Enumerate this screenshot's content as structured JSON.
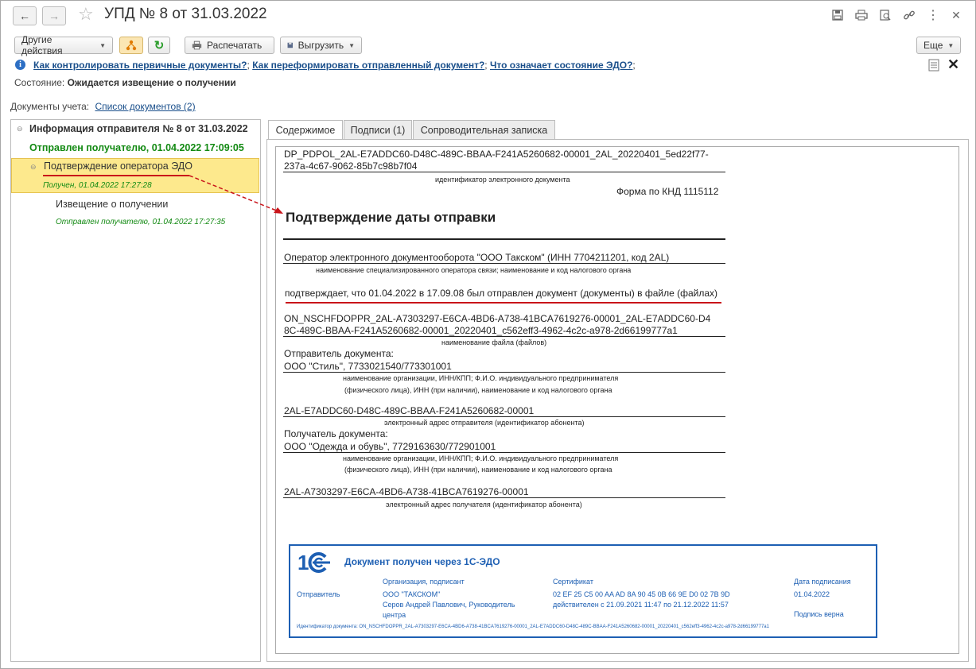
{
  "window": {
    "title": "УПД № 8 от 31.03.2022",
    "back_icon": "←",
    "forward_icon": "→",
    "star_icon": "☆"
  },
  "toolbar": {
    "other_actions": "Другие действия",
    "print": "Распечатать",
    "export": "Выгрузить",
    "more": "Еще"
  },
  "help_links": {
    "link1": "Как контролировать первичные документы?",
    "sep1": ";",
    "link2": "Как переформировать отправленный документ?",
    "sep2": ";",
    "link3": "Что означает состояние ЭДО?",
    "sep3": ";"
  },
  "status": {
    "label": "Состояние:",
    "value": "Ожидается извещение о получении"
  },
  "accounting_docs": {
    "label": "Документы учета:",
    "link": "Список документов (2)"
  },
  "tree": {
    "root_title": "Информация отправителя № 8 от 31.03.2022",
    "root_status": "Отправлен получателю, 01.04.2022 17:09:05",
    "child1_title": "Подтверждение оператора ЭДО",
    "child1_status": "Получен, 01.04.2022 17:27:28",
    "child2_title": "Извещение о получении",
    "child2_status": "Отправлен получателю, 01.04.2022 17:27:35"
  },
  "tabs": [
    "Содержимое",
    "Подписи (1)",
    "Сопроводительная записка"
  ],
  "document": {
    "id_line1": "DP_PDPOL_2AL-E7ADDC60-D48C-489C-BBAA-F241A5260682-00001_2AL_20220401_5ed22f77-",
    "id_line2": "237a-4c67-9062-85b7c98b7f04",
    "id_caption": "идентификатор электронного документа",
    "form_code": "Форма по КНД 1115112",
    "heading": "Подтверждение даты отправки",
    "operator": "Оператор электронного документооборота \"ООО Такском\" (ИНН 7704211201, код 2AL)",
    "operator_caption": "наименование специализированного оператора связи; наименование и код налогового органа",
    "confirms": "подтверждает, что 01.04.2022 в 17.09.08 был отправлен документ (документы) в файле (файлах)",
    "file_line1": "ON_NSCHFDOPPR_2AL-A7303297-E6CA-4BD6-A738-41BCA7619276-00001_2AL-E7ADDC60-D4",
    "file_line2": "8C-489C-BBAA-F241A5260682-00001_20220401_c562eff3-4962-4c2c-a978-2d66199777a1",
    "file_caption": "наименование файла (файлов)",
    "sender_label": "Отправитель документа:",
    "sender_value": "ООО \"Стиль\", 7733021540/773301001",
    "org_caption1": "наименование организации, ИНН/КПП; Ф.И.О. индивидуального предпринимателя",
    "org_caption2": "(физического лица), ИНН (при наличии), наименование и код налогового органа",
    "sender_address": "2AL-E7ADDC60-D48C-489C-BBAA-F241A5260682-00001",
    "sender_address_caption": "электронный адрес отправителя (идентификатор абонента)",
    "recipient_label": "Получатель документа:",
    "recipient_value": "ООО \"Одежда и обувь\", 7729163630/772901001",
    "recipient_address": "2AL-A7303297-E6CA-4BD6-A738-41BCA7619276-00001",
    "recipient_address_caption": "электронный адрес получателя (идентификатор абонента)"
  },
  "stamp": {
    "logo": "1С",
    "title": "Документ получен через 1С-ЭДО",
    "col_org": "Организация, подписант",
    "col_cert": "Сертификат",
    "col_date": "Дата подписания",
    "row_label": "Отправитель",
    "org_line1": "ООО \"ТАКСКОМ\"",
    "org_line2": "Серов Андрей Павлович, Руководитель",
    "org_line3": "центра",
    "cert_line1": "02 EF 25 C5 00 AA AD 8A 90 45 0B 66 9E D0 02 7B 9D",
    "cert_line2": "действителен с 21.09.2021 11:47 по 21.12.2022 11:57",
    "sign_date": "01.04.2022",
    "sign_status": "Подпись верна",
    "doc_id": "Идентификатор документа: ON_NSCHFDOPPR_2AL-A7303297-E6CA-4BD6-A738-41BCA7619276-00001_2AL-E7ADDC60-D48C-489C-BBAA-F241A5260682-00001_20220401_c562eff3-4962-4c2c-a978-2d66199777a1"
  },
  "colors": {
    "link": "#1a4f8b",
    "status_green": "#138a13",
    "highlight": "#fde98d",
    "stamp_blue": "#1d5fb3",
    "red_mark": "#c9141a"
  }
}
